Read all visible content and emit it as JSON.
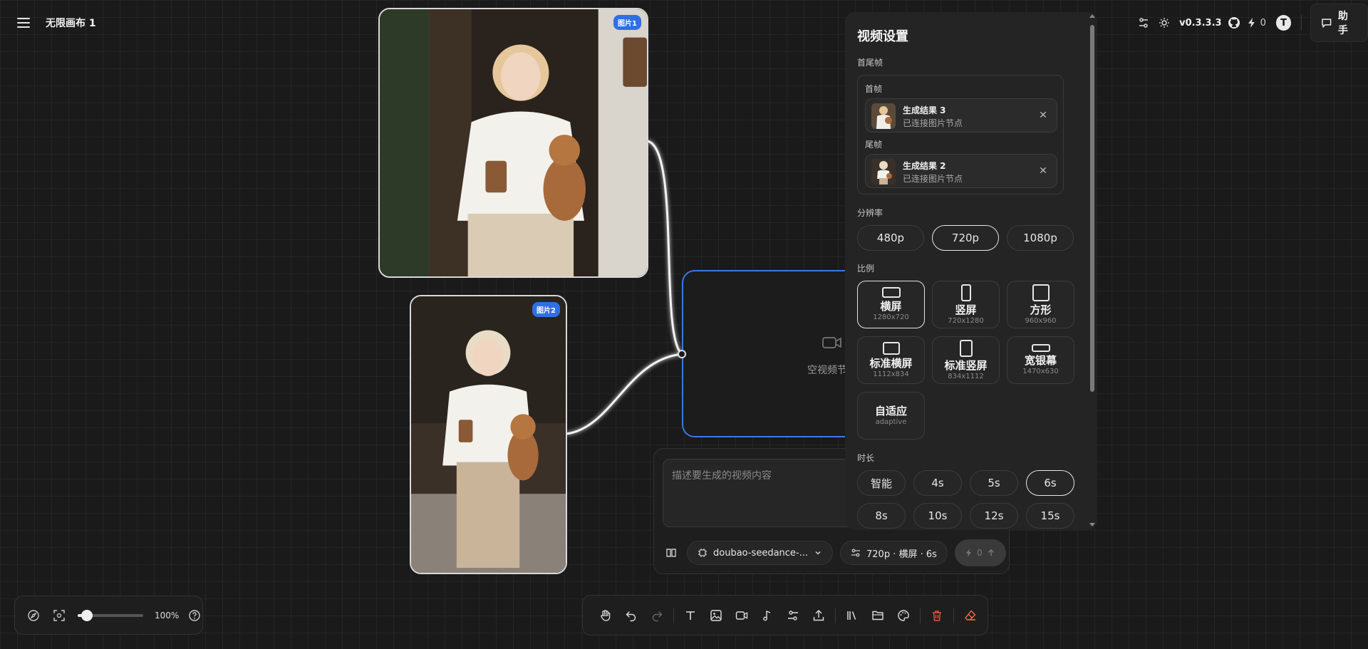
{
  "header": {
    "menu_icon": "menu-icon",
    "canvas_title": "无限画布 1",
    "version": "v0.3.3.3",
    "credits": "0",
    "avatar_letter": "T",
    "assistant_label": "助手"
  },
  "image_nodes": [
    {
      "tag": "图片1"
    },
    {
      "tag": "图片2"
    }
  ],
  "video_node": {
    "label": "空视频节"
  },
  "prompt": {
    "placeholder": "描述要生成的视频内容",
    "model": "doubao-seedance-...",
    "settings_summary": "720p · 横屏 · 6s",
    "send_credits": "0"
  },
  "settings": {
    "title": "视频设置",
    "frames_label": "首尾帧",
    "first_frame": {
      "label": "首帧",
      "name": "生成结果 3",
      "desc": "已连接图片节点"
    },
    "last_frame": {
      "label": "尾帧",
      "name": "生成结果 2",
      "desc": "已连接图片节点"
    },
    "resolution_label": "分辨率",
    "resolutions": [
      "480p",
      "720p",
      "1080p"
    ],
    "selected_resolution": "720p",
    "ratio_label": "比例",
    "ratios": [
      {
        "name": "横屏",
        "size": "1280x720"
      },
      {
        "name": "竖屏",
        "size": "720x1280"
      },
      {
        "name": "方形",
        "size": "960x960"
      },
      {
        "name": "标准横屏",
        "size": "1112x834"
      },
      {
        "name": "标准竖屏",
        "size": "834x1112"
      },
      {
        "name": "宽银幕",
        "size": "1470x630"
      },
      {
        "name": "自适应",
        "size": "adaptive"
      }
    ],
    "selected_ratio": "横屏",
    "duration_label": "时长",
    "durations": [
      "智能",
      "4s",
      "5s",
      "6s",
      "8s",
      "10s",
      "12s",
      "15s"
    ],
    "selected_duration": "6s"
  },
  "zoom": {
    "percent": "100%",
    "level": 0.1
  },
  "colors": {
    "accent": "#3a78e8",
    "tag": "#2f6fe6",
    "delete": "#e5533d",
    "eraser": "#ff6b4a"
  }
}
